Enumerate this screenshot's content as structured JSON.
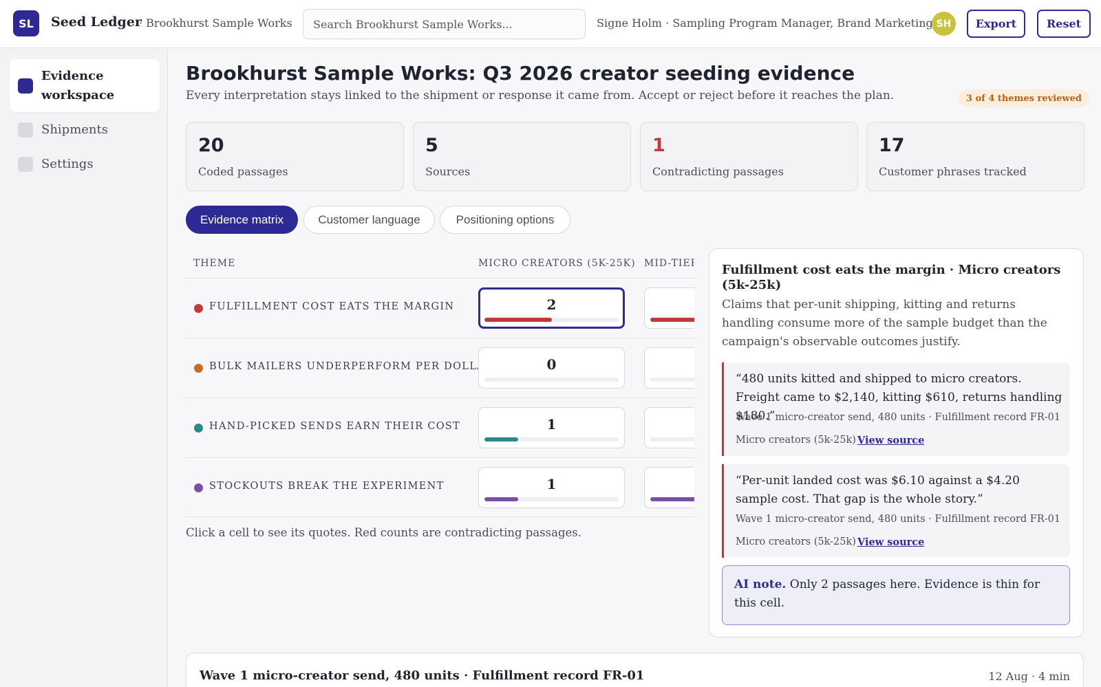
{
  "header": {
    "logo_initials": "SL",
    "app_name": "Seed Ledger",
    "workspace_crumb": "· Brookhurst Sample Works",
    "search_placeholder": "Search Brookhurst Sample Works...",
    "user_line": "Signe Holm · Sampling Program Manager, Brand Marketing",
    "avatar_initials": "SH",
    "export_label": "Export",
    "reset_label": "Reset",
    "avatar_color": "#c9c23b",
    "accent_color": "#2e2a94"
  },
  "sidebar": {
    "items": [
      {
        "label": "Evidence workspace",
        "active": true
      },
      {
        "label": "Shipments",
        "active": false
      },
      {
        "label": "Settings",
        "active": false
      }
    ]
  },
  "page": {
    "title": "Brookhurst Sample Works: Q3 2026 creator seeding evidence",
    "subtitle": "Every interpretation stays linked to the shipment or response it came from. Accept or reject before it reaches the plan.",
    "review_badge": "3 of 4 themes reviewed"
  },
  "stats": [
    {
      "value": "20",
      "label": "Coded passages"
    },
    {
      "value": "5",
      "label": "Sources"
    },
    {
      "value": "1",
      "label": "Contradicting passages",
      "alert": true
    },
    {
      "value": "17",
      "label": "Customer phrases tracked"
    }
  ],
  "tabs": [
    {
      "label": "Evidence matrix",
      "active": true
    },
    {
      "label": "Customer language",
      "active": false
    },
    {
      "label": "Positioning options",
      "active": false
    }
  ],
  "matrix": {
    "columns": [
      "THEME",
      "MICRO CREATORS (5K-25K)",
      "MID-TIER"
    ],
    "rows": [
      {
        "theme": "FULFILLMENT COST EATS THE MARGIN",
        "color": "#c0393b",
        "micro_count": "2",
        "micro_fill": 0.5,
        "mid_fill": 0.9,
        "selected": true
      },
      {
        "theme": "BULK MAILERS UNDERPERFORM PER DOLLAR",
        "color": "#c46f24",
        "micro_count": "0",
        "micro_fill": 0.0,
        "mid_fill": 0.0,
        "selected": false
      },
      {
        "theme": "HAND-PICKED SENDS EARN THEIR COST",
        "color": "#2a8a86",
        "micro_count": "1",
        "micro_fill": 0.25,
        "mid_fill": 0.0,
        "selected": false
      },
      {
        "theme": "STOCKOUTS BREAK THE EXPERIMENT",
        "color": "#7a4fa8",
        "micro_count": "1",
        "micro_fill": 0.25,
        "mid_fill": 0.9,
        "selected": false
      }
    ],
    "hint": "Click a cell to see its quotes. Red counts are contradicting passages."
  },
  "detail": {
    "title": "Fulfillment cost eats the margin · Micro creators (5k-25k)",
    "description": "Claims that per-unit shipping, kitting and returns handling consume more of the sample budget than the campaign's observable outcomes justify.",
    "quotes": [
      {
        "text": "“480 units kitted and shipped to micro creators. Freight came to $2,140, kitting $610, returns handling $180.”",
        "source": "Wave 1 micro-creator send, 480 units · Fulfillment record FR-01",
        "segment": "Micro creators (5k-25k)",
        "link": "View source"
      },
      {
        "text": "“Per-unit landed cost was $6.10 against a $4.20 sample cost. That gap is the whole story.”",
        "source": "Wave 1 micro-creator send, 480 units · Fulfillment record FR-01",
        "segment": "Micro creators (5k-25k)",
        "link": "View source"
      }
    ],
    "ai_note_tag": "AI note.",
    "ai_note_text": " Only 2 passages here. Evidence is thin for this cell."
  },
  "source_card": {
    "title": "Wave 1 micro-creator send, 480 units · Fulfillment record FR-01",
    "meta": "12 Aug · 4 min"
  }
}
